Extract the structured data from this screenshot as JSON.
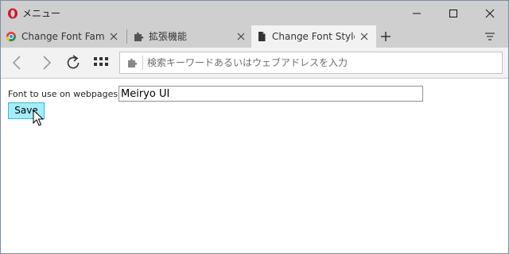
{
  "titlebar": {
    "menu_label": "メニュー",
    "minimize_glyph": "—",
    "maximize_glyph": "☐",
    "close_glyph": "✕"
  },
  "tabs": [
    {
      "title": "Change Font Family",
      "icon": "chrome-favicon-icon",
      "active": false
    },
    {
      "title": "拡張機能",
      "icon": "puzzle-icon",
      "active": false
    },
    {
      "title": "Change Font Style C",
      "icon": "document-icon",
      "active": true
    }
  ],
  "toolbar": {
    "new_tab_icon": "plus-icon",
    "tab_menu_icon": "tab-menu-icon"
  },
  "address": {
    "placeholder": "検索キーワードあるいはウェブアドレスを入力"
  },
  "page": {
    "font_label": "Font to use on webpages:",
    "font_value": "Meiryo UI",
    "save_label": "Save"
  },
  "colors": {
    "accent_opera": "#d3122b",
    "save_bg": "#a3eefc",
    "chrome_bg": "#cfcfcf"
  }
}
